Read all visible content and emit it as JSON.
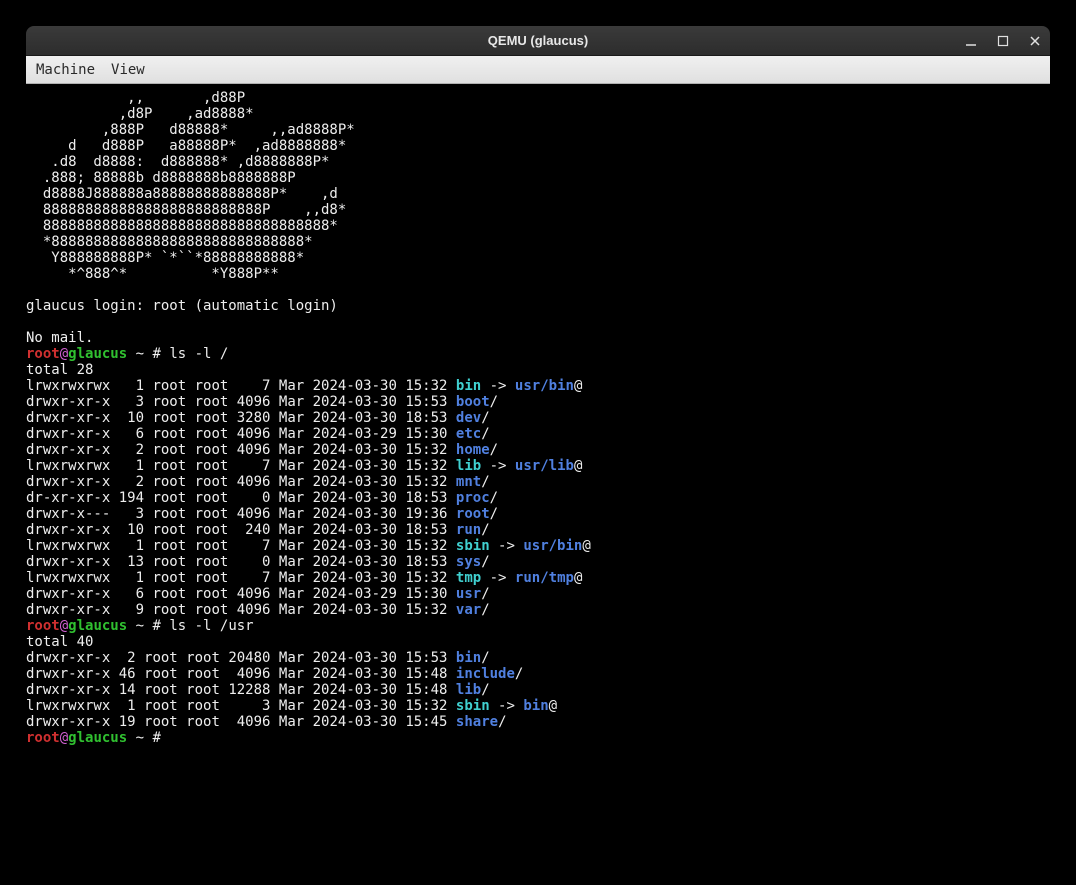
{
  "titlebar": {
    "title": "QEMU (glaucus)"
  },
  "menubar": {
    "items": [
      "Machine",
      "View"
    ]
  },
  "ascii_art": [
    "            ,,       ,d88P",
    "           ,d8P    ,ad8888*",
    "         ,888P   d88888*     ,,ad8888P*",
    "     d   d888P   a88888P*  ,ad8888888*",
    "   .d8  d8888:  d888888* ,d8888888P*",
    "  .888; 88888b d8888888b8888888P",
    "  d8888J888888a88888888888888P*    ,d",
    "  88888888888888888888888888P    ,,d8*",
    "  8888888888888888888888888888888888*",
    "  *888888888888888888888888888888*",
    "   Y888888888P* `*``*88888888888*",
    "     *^888^*          *Y888P**"
  ],
  "login_line": "glaucus login: root (automatic login)",
  "no_mail": "No mail.",
  "prompt": {
    "user": "root",
    "at": "@",
    "host": "glaucus",
    "tilde": " ~ ",
    "hash": "# "
  },
  "cmd1": "ls -l /",
  "total1": "total 28",
  "ls1": [
    {
      "perm": "lrwxrwxrwx",
      "n": "   1",
      "ow": " root root",
      "sz": "    7",
      "dt": " Mar 2024-03-30 15:32 ",
      "name": "bin",
      "link": true,
      "target": "usr/bin",
      "suf": "@",
      "cls": "c-cyan",
      "tcls": "c-blue"
    },
    {
      "perm": "drwxr-xr-x",
      "n": "   3",
      "ow": " root root",
      "sz": " 4096",
      "dt": " Mar 2024-03-30 15:53 ",
      "name": "boot",
      "link": false,
      "suf": "/",
      "cls": "c-blue"
    },
    {
      "perm": "drwxr-xr-x",
      "n": "  10",
      "ow": " root root",
      "sz": " 3280",
      "dt": " Mar 2024-03-30 18:53 ",
      "name": "dev",
      "link": false,
      "suf": "/",
      "cls": "c-blue"
    },
    {
      "perm": "drwxr-xr-x",
      "n": "   6",
      "ow": " root root",
      "sz": " 4096",
      "dt": " Mar 2024-03-29 15:30 ",
      "name": "etc",
      "link": false,
      "suf": "/",
      "cls": "c-blue"
    },
    {
      "perm": "drwxr-xr-x",
      "n": "   2",
      "ow": " root root",
      "sz": " 4096",
      "dt": " Mar 2024-03-30 15:32 ",
      "name": "home",
      "link": false,
      "suf": "/",
      "cls": "c-blue"
    },
    {
      "perm": "lrwxrwxrwx",
      "n": "   1",
      "ow": " root root",
      "sz": "    7",
      "dt": " Mar 2024-03-30 15:32 ",
      "name": "lib",
      "link": true,
      "target": "usr/lib",
      "suf": "@",
      "cls": "c-cyan",
      "tcls": "c-blue"
    },
    {
      "perm": "drwxr-xr-x",
      "n": "   2",
      "ow": " root root",
      "sz": " 4096",
      "dt": " Mar 2024-03-30 15:32 ",
      "name": "mnt",
      "link": false,
      "suf": "/",
      "cls": "c-blue"
    },
    {
      "perm": "dr-xr-xr-x",
      "n": " 194",
      "ow": " root root",
      "sz": "    0",
      "dt": " Mar 2024-03-30 18:53 ",
      "name": "proc",
      "link": false,
      "suf": "/",
      "cls": "c-blue"
    },
    {
      "perm": "drwxr-x---",
      "n": "   3",
      "ow": " root root",
      "sz": " 4096",
      "dt": " Mar 2024-03-30 19:36 ",
      "name": "root",
      "link": false,
      "suf": "/",
      "cls": "c-blue"
    },
    {
      "perm": "drwxr-xr-x",
      "n": "  10",
      "ow": " root root",
      "sz": "  240",
      "dt": " Mar 2024-03-30 18:53 ",
      "name": "run",
      "link": false,
      "suf": "/",
      "cls": "c-blue"
    },
    {
      "perm": "lrwxrwxrwx",
      "n": "   1",
      "ow": " root root",
      "sz": "    7",
      "dt": " Mar 2024-03-30 15:32 ",
      "name": "sbin",
      "link": true,
      "target": "usr/bin",
      "suf": "@",
      "cls": "c-cyan",
      "tcls": "c-blue"
    },
    {
      "perm": "drwxr-xr-x",
      "n": "  13",
      "ow": " root root",
      "sz": "    0",
      "dt": " Mar 2024-03-30 18:53 ",
      "name": "sys",
      "link": false,
      "suf": "/",
      "cls": "c-blue"
    },
    {
      "perm": "lrwxrwxrwx",
      "n": "   1",
      "ow": " root root",
      "sz": "    7",
      "dt": " Mar 2024-03-30 15:32 ",
      "name": "tmp",
      "link": true,
      "target": "run/tmp",
      "suf": "@",
      "cls": "c-cyan",
      "tcls": "c-blue"
    },
    {
      "perm": "drwxr-xr-x",
      "n": "   6",
      "ow": " root root",
      "sz": " 4096",
      "dt": " Mar 2024-03-29 15:30 ",
      "name": "usr",
      "link": false,
      "suf": "/",
      "cls": "c-blue"
    },
    {
      "perm": "drwxr-xr-x",
      "n": "   9",
      "ow": " root root",
      "sz": " 4096",
      "dt": " Mar 2024-03-30 15:32 ",
      "name": "var",
      "link": false,
      "suf": "/",
      "cls": "c-blue"
    }
  ],
  "cmd2": "ls -l /usr",
  "total2": "total 40",
  "ls2": [
    {
      "perm": "drwxr-xr-x",
      "n": "  2",
      "ow": " root root",
      "sz": " 20480",
      "dt": " Mar 2024-03-30 15:53 ",
      "name": "bin",
      "link": false,
      "suf": "/",
      "cls": "c-blue"
    },
    {
      "perm": "drwxr-xr-x",
      "n": " 46",
      "ow": " root root",
      "sz": "  4096",
      "dt": " Mar 2024-03-30 15:48 ",
      "name": "include",
      "link": false,
      "suf": "/",
      "cls": "c-blue"
    },
    {
      "perm": "drwxr-xr-x",
      "n": " 14",
      "ow": " root root",
      "sz": " 12288",
      "dt": " Mar 2024-03-30 15:48 ",
      "name": "lib",
      "link": false,
      "suf": "/",
      "cls": "c-blue"
    },
    {
      "perm": "lrwxrwxrwx",
      "n": "  1",
      "ow": " root root",
      "sz": "     3",
      "dt": " Mar 2024-03-30 15:32 ",
      "name": "sbin",
      "link": true,
      "target": "bin",
      "suf": "@",
      "cls": "c-cyan",
      "tcls": "c-blue"
    },
    {
      "perm": "drwxr-xr-x",
      "n": " 19",
      "ow": " root root",
      "sz": "  4096",
      "dt": " Mar 2024-03-30 15:45 ",
      "name": "share",
      "link": false,
      "suf": "/",
      "cls": "c-blue"
    }
  ]
}
